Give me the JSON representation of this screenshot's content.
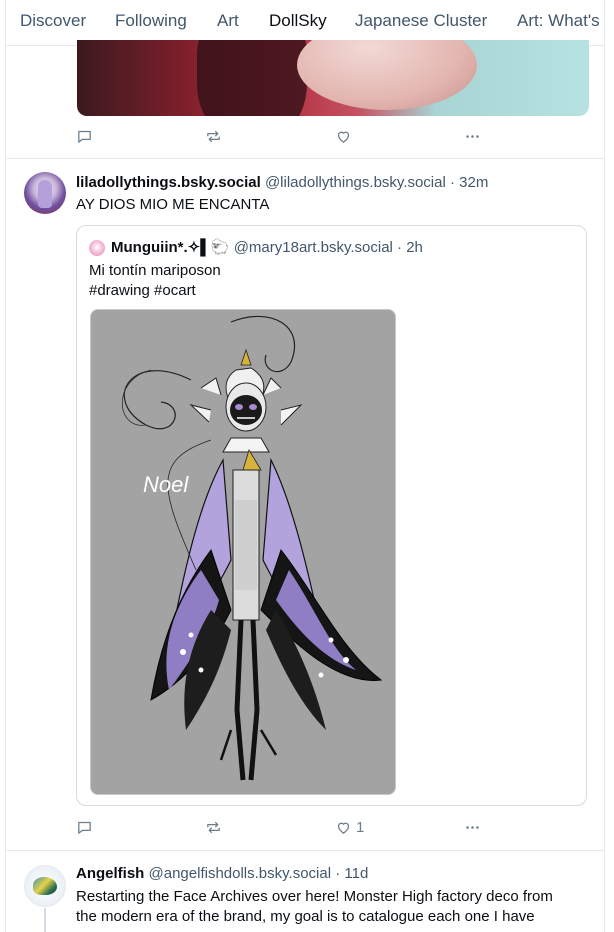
{
  "tabs": [
    {
      "label": "Discover",
      "active": false
    },
    {
      "label": "Following",
      "active": false
    },
    {
      "label": "Art",
      "active": false
    },
    {
      "label": "DollSky",
      "active": true
    },
    {
      "label": "Japanese Cluster",
      "active": false
    },
    {
      "label": "Art: What's",
      "active": false
    }
  ],
  "accent_color": "#1083fe",
  "posts": [
    {
      "actions": {
        "reply_count": "",
        "repost_count": "",
        "like_count": ""
      }
    },
    {
      "display_name": "liladollythings.bsky.social",
      "handle": "@liladollythings.bsky.social",
      "time": "· 32m",
      "text": "AY DIOS MIO ME ENCANTA",
      "quote": {
        "display_name": "Munguiin*.✧▌🐑",
        "handle": "@mary18art.bsky.social",
        "time": "· 2h",
        "text_line1": "Mi tontín mariposon",
        "text_line2": "#drawing #ocart",
        "image_caption": "Noel"
      },
      "actions": {
        "reply_count": "",
        "repost_count": "",
        "like_count": "1"
      }
    },
    {
      "display_name": "Angelfish",
      "handle": "@angelfishdolls.bsky.social",
      "time": "· 11d",
      "text_line1": "Restarting the Face Archives over here! Monster High factory deco from",
      "text_line2": "the modern era of the brand, my goal is to catalogue each one I have"
    }
  ],
  "icons": [
    "reply-icon",
    "repost-icon",
    "like-icon",
    "more-icon"
  ]
}
